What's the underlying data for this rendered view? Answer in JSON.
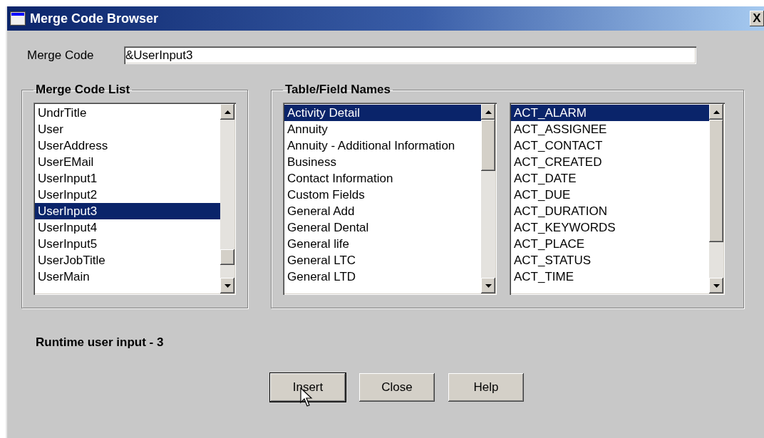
{
  "window": {
    "title": "Merge Code Browser",
    "close_label": "X"
  },
  "merge_code": {
    "label": "Merge Code",
    "value": "&UserInput3"
  },
  "merge_code_list": {
    "title": "Merge Code List",
    "items": [
      {
        "label": "UndrTitle",
        "selected": false
      },
      {
        "label": "User",
        "selected": false
      },
      {
        "label": "UserAddress",
        "selected": false
      },
      {
        "label": "UserEMail",
        "selected": false
      },
      {
        "label": "UserInput1",
        "selected": false
      },
      {
        "label": "UserInput2",
        "selected": false
      },
      {
        "label": "UserInput3",
        "selected": true
      },
      {
        "label": "UserInput4",
        "selected": false
      },
      {
        "label": "UserInput5",
        "selected": false
      },
      {
        "label": "UserJobTitle",
        "selected": false
      },
      {
        "label": "UserMain",
        "selected": false
      }
    ]
  },
  "table_field_names": {
    "title": "Table/Field Names",
    "tables": [
      {
        "label": "Activity Detail",
        "selected": true
      },
      {
        "label": "Annuity",
        "selected": false
      },
      {
        "label": "Annuity - Additional Information",
        "selected": false
      },
      {
        "label": "Business",
        "selected": false
      },
      {
        "label": "Contact Information",
        "selected": false
      },
      {
        "label": "Custom Fields",
        "selected": false
      },
      {
        "label": "General Add",
        "selected": false
      },
      {
        "label": "General Dental",
        "selected": false
      },
      {
        "label": "General life",
        "selected": false
      },
      {
        "label": "General LTC",
        "selected": false
      },
      {
        "label": "General LTD",
        "selected": false
      }
    ],
    "fields": [
      {
        "label": "ACT_ALARM",
        "selected": true
      },
      {
        "label": "ACT_ASSIGNEE",
        "selected": false
      },
      {
        "label": "ACT_CONTACT",
        "selected": false
      },
      {
        "label": "ACT_CREATED",
        "selected": false
      },
      {
        "label": "ACT_DATE",
        "selected": false
      },
      {
        "label": "ACT_DUE",
        "selected": false
      },
      {
        "label": "ACT_DURATION",
        "selected": false
      },
      {
        "label": "ACT_KEYWORDS",
        "selected": false
      },
      {
        "label": "ACT_PLACE",
        "selected": false
      },
      {
        "label": "ACT_STATUS",
        "selected": false
      },
      {
        "label": "ACT_TIME",
        "selected": false
      }
    ]
  },
  "description": "Runtime user input - 3",
  "buttons": [
    {
      "label": "Insert",
      "focused": true
    },
    {
      "label": "Close",
      "focused": false
    },
    {
      "label": "Help",
      "focused": false
    }
  ]
}
